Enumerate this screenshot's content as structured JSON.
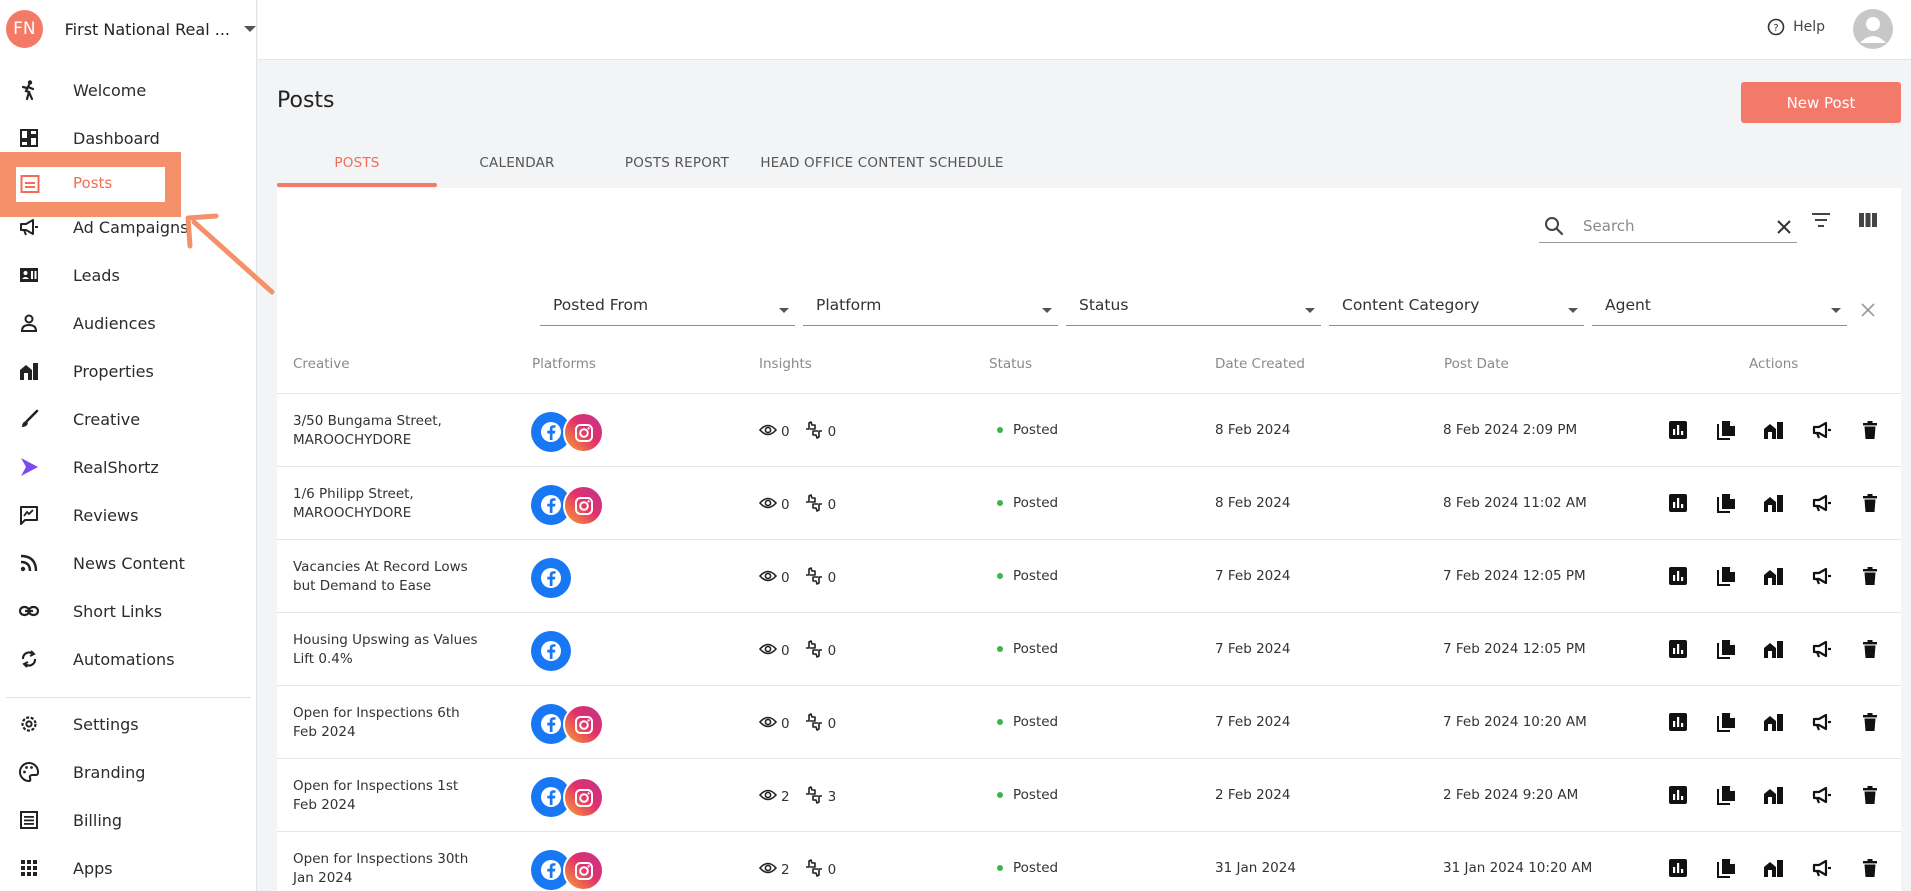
{
  "org": {
    "initials": "FN",
    "name": "First National Real ..."
  },
  "nav": [
    {
      "label": "Welcome",
      "icon": "walking-person-icon"
    },
    {
      "label": "Dashboard",
      "icon": "dashboard-icon"
    },
    {
      "label": "Posts",
      "icon": "posts-icon",
      "active": true
    },
    {
      "label": "Ad Campaigns",
      "icon": "megaphone-icon"
    },
    {
      "label": "Leads",
      "icon": "contact-card-icon"
    },
    {
      "label": "Audiences",
      "icon": "person-icon"
    },
    {
      "label": "Properties",
      "icon": "buildings-icon"
    },
    {
      "label": "Creative",
      "icon": "paintbrush-icon"
    },
    {
      "label": "RealShortz",
      "icon": "play-icon"
    },
    {
      "label": "Reviews",
      "icon": "rate-review-icon"
    },
    {
      "label": "News Content",
      "icon": "rss-icon"
    },
    {
      "label": "Short Links",
      "icon": "link-icon"
    },
    {
      "label": "Automations",
      "icon": "sync-icon"
    },
    {
      "label": "Settings",
      "icon": "gear-icon"
    },
    {
      "label": "Branding",
      "icon": "palette-icon"
    },
    {
      "label": "Billing",
      "icon": "receipt-icon"
    },
    {
      "label": "Apps",
      "icon": "apps-grid-icon"
    }
  ],
  "topbar": {
    "help": "Help"
  },
  "page": {
    "title": "Posts",
    "new_post": "New Post"
  },
  "tabs": [
    "POSTS",
    "CALENDAR",
    "POSTS REPORT",
    "HEAD OFFICE CONTENT SCHEDULE"
  ],
  "search": {
    "placeholder": "Search"
  },
  "filters": [
    "Posted From",
    "Platform",
    "Status",
    "Content Category",
    "Agent"
  ],
  "columns": [
    "Creative",
    "Platforms",
    "Insights",
    "Status",
    "Date Created",
    "Post Date",
    "Actions"
  ],
  "rows": [
    {
      "creative": "3/50 Bungama Street, MAROOCHYDORE",
      "platforms": [
        "facebook",
        "instagram"
      ],
      "views": "0",
      "engagements": "0",
      "status": "Posted",
      "date_created": "8 Feb 2024",
      "post_date": "8 Feb 2024 2:09 PM"
    },
    {
      "creative": "1/6 Philipp Street, MAROOCHYDORE",
      "platforms": [
        "facebook",
        "instagram"
      ],
      "views": "0",
      "engagements": "0",
      "status": "Posted",
      "date_created": "8 Feb 2024",
      "post_date": "8 Feb 2024 11:02 AM"
    },
    {
      "creative": "Vacancies At Record Lows but Demand to Ease",
      "platforms": [
        "facebook"
      ],
      "views": "0",
      "engagements": "0",
      "status": "Posted",
      "date_created": "7 Feb 2024",
      "post_date": "7 Feb 2024 12:05 PM"
    },
    {
      "creative": "Housing Upswing as Values Lift 0.4%",
      "platforms": [
        "facebook"
      ],
      "views": "0",
      "engagements": "0",
      "status": "Posted",
      "date_created": "7 Feb 2024",
      "post_date": "7 Feb 2024 12:05 PM"
    },
    {
      "creative": "Open for Inspections 6th Feb 2024",
      "platforms": [
        "facebook",
        "instagram"
      ],
      "views": "0",
      "engagements": "0",
      "status": "Posted",
      "date_created": "7 Feb 2024",
      "post_date": "7 Feb 2024 10:20 AM"
    },
    {
      "creative": "Open for Inspections 1st Feb 2024",
      "platforms": [
        "facebook",
        "instagram"
      ],
      "views": "2",
      "engagements": "3",
      "status": "Posted",
      "date_created": "2 Feb 2024",
      "post_date": "2 Feb 2024 9:20 AM"
    },
    {
      "creative": "Open for Inspections 30th Jan 2024",
      "platforms": [
        "facebook",
        "instagram"
      ],
      "views": "2",
      "engagements": "0",
      "status": "Posted",
      "date_created": "31 Jan 2024",
      "post_date": "31 Jan 2024 10:20 AM"
    }
  ],
  "colors": {
    "accent": "#f37a6b",
    "highlight": "#f5916a",
    "posted": "#3bb54a",
    "facebook": "#1877f2"
  }
}
